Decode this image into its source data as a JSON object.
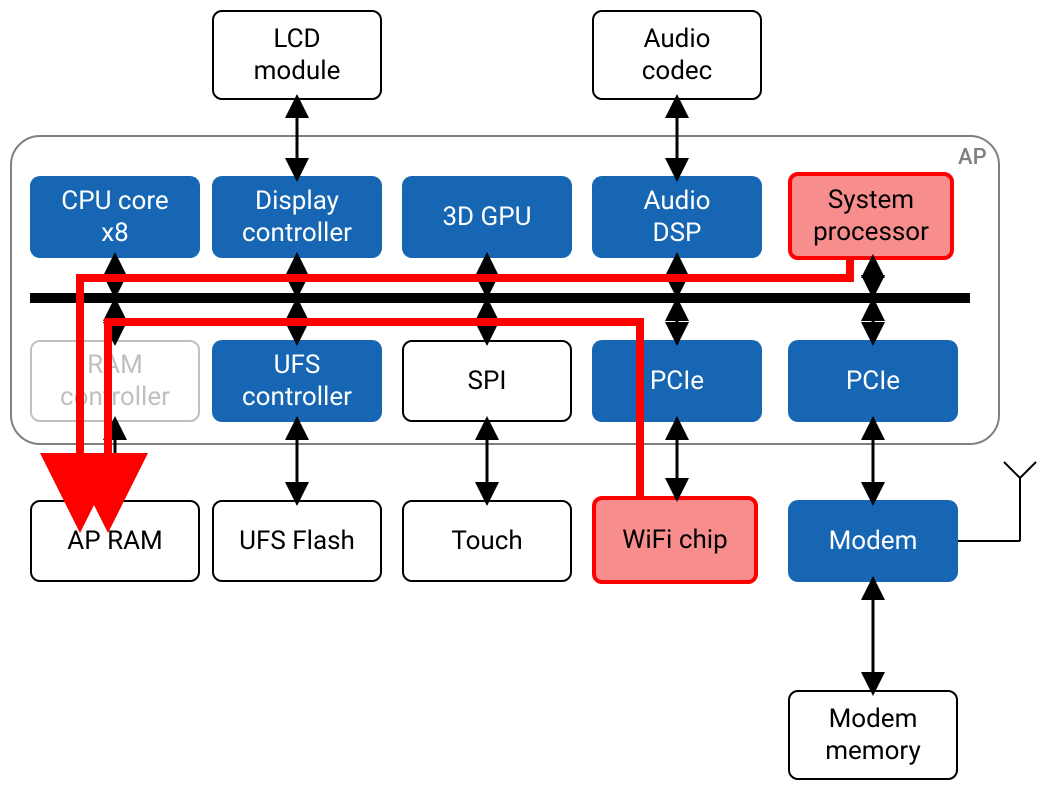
{
  "ap_label": "AP",
  "blocks": {
    "lcd_module": "LCD\nmodule",
    "audio_codec": "Audio\ncodec",
    "cpu_core": "CPU core\nx8",
    "display_controller": "Display\ncontroller",
    "gpu": "3D GPU",
    "audio_dsp": "Audio\nDSP",
    "system_processor": "System\nprocessor",
    "ram_controller": "RAM\ncontroller",
    "ufs_controller": "UFS\ncontroller",
    "spi": "SPI",
    "pcie_1": "PCIe",
    "pcie_2": "PCIe",
    "ap_ram": "AP RAM",
    "ufs_flash": "UFS Flash",
    "touch": "Touch",
    "wifi_chip": "WiFi chip",
    "modem": "Modem",
    "modem_memory": "Modem\nmemory"
  }
}
